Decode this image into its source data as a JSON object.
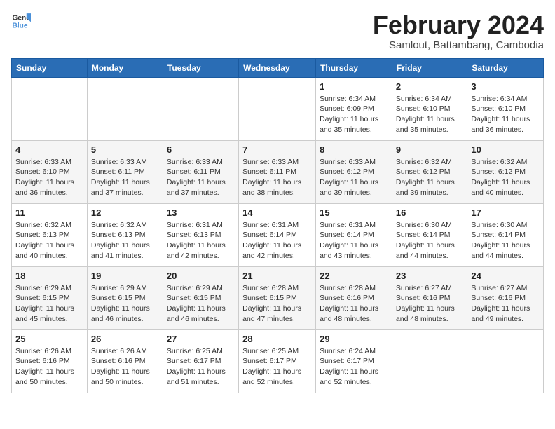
{
  "header": {
    "logo_general": "General",
    "logo_blue": "Blue",
    "title": "February 2024",
    "subtitle": "Samlout, Battambang, Cambodia"
  },
  "days_of_week": [
    "Sunday",
    "Monday",
    "Tuesday",
    "Wednesday",
    "Thursday",
    "Friday",
    "Saturday"
  ],
  "weeks": [
    [
      {
        "day": "",
        "info": ""
      },
      {
        "day": "",
        "info": ""
      },
      {
        "day": "",
        "info": ""
      },
      {
        "day": "",
        "info": ""
      },
      {
        "day": "1",
        "info": "Sunrise: 6:34 AM\nSunset: 6:09 PM\nDaylight: 11 hours\nand 35 minutes."
      },
      {
        "day": "2",
        "info": "Sunrise: 6:34 AM\nSunset: 6:10 PM\nDaylight: 11 hours\nand 35 minutes."
      },
      {
        "day": "3",
        "info": "Sunrise: 6:34 AM\nSunset: 6:10 PM\nDaylight: 11 hours\nand 36 minutes."
      }
    ],
    [
      {
        "day": "4",
        "info": "Sunrise: 6:33 AM\nSunset: 6:10 PM\nDaylight: 11 hours\nand 36 minutes."
      },
      {
        "day": "5",
        "info": "Sunrise: 6:33 AM\nSunset: 6:11 PM\nDaylight: 11 hours\nand 37 minutes."
      },
      {
        "day": "6",
        "info": "Sunrise: 6:33 AM\nSunset: 6:11 PM\nDaylight: 11 hours\nand 37 minutes."
      },
      {
        "day": "7",
        "info": "Sunrise: 6:33 AM\nSunset: 6:11 PM\nDaylight: 11 hours\nand 38 minutes."
      },
      {
        "day": "8",
        "info": "Sunrise: 6:33 AM\nSunset: 6:12 PM\nDaylight: 11 hours\nand 39 minutes."
      },
      {
        "day": "9",
        "info": "Sunrise: 6:32 AM\nSunset: 6:12 PM\nDaylight: 11 hours\nand 39 minutes."
      },
      {
        "day": "10",
        "info": "Sunrise: 6:32 AM\nSunset: 6:12 PM\nDaylight: 11 hours\nand 40 minutes."
      }
    ],
    [
      {
        "day": "11",
        "info": "Sunrise: 6:32 AM\nSunset: 6:13 PM\nDaylight: 11 hours\nand 40 minutes."
      },
      {
        "day": "12",
        "info": "Sunrise: 6:32 AM\nSunset: 6:13 PM\nDaylight: 11 hours\nand 41 minutes."
      },
      {
        "day": "13",
        "info": "Sunrise: 6:31 AM\nSunset: 6:13 PM\nDaylight: 11 hours\nand 42 minutes."
      },
      {
        "day": "14",
        "info": "Sunrise: 6:31 AM\nSunset: 6:14 PM\nDaylight: 11 hours\nand 42 minutes."
      },
      {
        "day": "15",
        "info": "Sunrise: 6:31 AM\nSunset: 6:14 PM\nDaylight: 11 hours\nand 43 minutes."
      },
      {
        "day": "16",
        "info": "Sunrise: 6:30 AM\nSunset: 6:14 PM\nDaylight: 11 hours\nand 44 minutes."
      },
      {
        "day": "17",
        "info": "Sunrise: 6:30 AM\nSunset: 6:14 PM\nDaylight: 11 hours\nand 44 minutes."
      }
    ],
    [
      {
        "day": "18",
        "info": "Sunrise: 6:29 AM\nSunset: 6:15 PM\nDaylight: 11 hours\nand 45 minutes."
      },
      {
        "day": "19",
        "info": "Sunrise: 6:29 AM\nSunset: 6:15 PM\nDaylight: 11 hours\nand 46 minutes."
      },
      {
        "day": "20",
        "info": "Sunrise: 6:29 AM\nSunset: 6:15 PM\nDaylight: 11 hours\nand 46 minutes."
      },
      {
        "day": "21",
        "info": "Sunrise: 6:28 AM\nSunset: 6:15 PM\nDaylight: 11 hours\nand 47 minutes."
      },
      {
        "day": "22",
        "info": "Sunrise: 6:28 AM\nSunset: 6:16 PM\nDaylight: 11 hours\nand 48 minutes."
      },
      {
        "day": "23",
        "info": "Sunrise: 6:27 AM\nSunset: 6:16 PM\nDaylight: 11 hours\nand 48 minutes."
      },
      {
        "day": "24",
        "info": "Sunrise: 6:27 AM\nSunset: 6:16 PM\nDaylight: 11 hours\nand 49 minutes."
      }
    ],
    [
      {
        "day": "25",
        "info": "Sunrise: 6:26 AM\nSunset: 6:16 PM\nDaylight: 11 hours\nand 50 minutes."
      },
      {
        "day": "26",
        "info": "Sunrise: 6:26 AM\nSunset: 6:16 PM\nDaylight: 11 hours\nand 50 minutes."
      },
      {
        "day": "27",
        "info": "Sunrise: 6:25 AM\nSunset: 6:17 PM\nDaylight: 11 hours\nand 51 minutes."
      },
      {
        "day": "28",
        "info": "Sunrise: 6:25 AM\nSunset: 6:17 PM\nDaylight: 11 hours\nand 52 minutes."
      },
      {
        "day": "29",
        "info": "Sunrise: 6:24 AM\nSunset: 6:17 PM\nDaylight: 11 hours\nand 52 minutes."
      },
      {
        "day": "",
        "info": ""
      },
      {
        "day": "",
        "info": ""
      }
    ]
  ]
}
